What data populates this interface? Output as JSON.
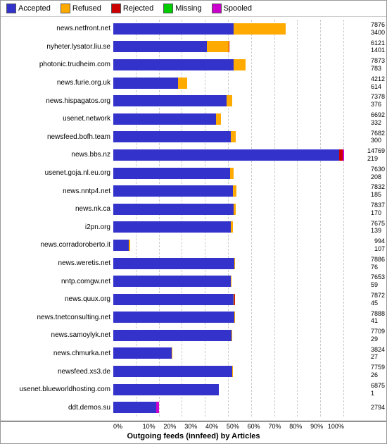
{
  "legend": {
    "items": [
      {
        "label": "Accepted",
        "color": "#3333cc",
        "class": "color-accepted"
      },
      {
        "label": "Refused",
        "color": "#ffaa00",
        "class": "color-refused"
      },
      {
        "label": "Rejected",
        "color": "#cc0000",
        "class": "color-rejected"
      },
      {
        "label": "Missing",
        "color": "#00cc00",
        "class": "color-missing"
      },
      {
        "label": "Spooled",
        "color": "#cc00cc",
        "class": "color-spooled"
      }
    ]
  },
  "title": "Outgoing feeds (innfeed) by Articles",
  "xAxis": {
    "ticks": [
      "0%",
      "10%",
      "20%",
      "30%",
      "40%",
      "50%",
      "60%",
      "70%",
      "80%",
      "90%",
      "100%"
    ]
  },
  "bars": [
    {
      "label": "news.netfront.net",
      "accepted": 7876,
      "refused": 3400,
      "rejected": 0,
      "missing": 0,
      "spooled": 0,
      "total": 11276,
      "val1": "7876",
      "val2": "3400"
    },
    {
      "label": "nyheter.lysator.liu.se",
      "accepted": 6121,
      "refused": 1401,
      "rejected": 30,
      "missing": 0,
      "spooled": 0,
      "total": 7552,
      "val1": "6121",
      "val2": "1401"
    },
    {
      "label": "photonic.trudheim.com",
      "accepted": 7873,
      "refused": 783,
      "rejected": 0,
      "missing": 0,
      "spooled": 0,
      "total": 8656,
      "val1": "7873",
      "val2": "783"
    },
    {
      "label": "news.furie.org.uk",
      "accepted": 4212,
      "refused": 614,
      "rejected": 0,
      "missing": 0,
      "spooled": 0,
      "total": 4826,
      "val1": "4212",
      "val2": "614"
    },
    {
      "label": "news.hispagatos.org",
      "accepted": 7378,
      "refused": 376,
      "rejected": 0,
      "missing": 0,
      "spooled": 0,
      "total": 7754,
      "val1": "7378",
      "val2": "376"
    },
    {
      "label": "usenet.network",
      "accepted": 6692,
      "refused": 332,
      "rejected": 0,
      "missing": 0,
      "spooled": 0,
      "total": 7024,
      "val1": "6692",
      "val2": "332"
    },
    {
      "label": "newsfeed.bofh.team",
      "accepted": 7682,
      "refused": 300,
      "rejected": 0,
      "missing": 0,
      "spooled": 0,
      "total": 7982,
      "val1": "7682",
      "val2": "300"
    },
    {
      "label": "news.bbs.nz",
      "accepted": 14769,
      "refused": 0,
      "rejected": 219,
      "missing": 0,
      "spooled": 80,
      "total": 15068,
      "val1": "14769",
      "val2": "219"
    },
    {
      "label": "usenet.goja.nl.eu.org",
      "accepted": 7630,
      "refused": 208,
      "rejected": 0,
      "missing": 0,
      "spooled": 0,
      "total": 7838,
      "val1": "7630",
      "val2": "208"
    },
    {
      "label": "news.nntp4.net",
      "accepted": 7832,
      "refused": 185,
      "rejected": 0,
      "missing": 0,
      "spooled": 0,
      "total": 8017,
      "val1": "7832",
      "val2": "185"
    },
    {
      "label": "news.nk.ca",
      "accepted": 7837,
      "refused": 170,
      "rejected": 0,
      "missing": 0,
      "spooled": 0,
      "total": 8007,
      "val1": "7837",
      "val2": "170"
    },
    {
      "label": "i2pn.org",
      "accepted": 7675,
      "refused": 139,
      "rejected": 0,
      "missing": 0,
      "spooled": 0,
      "total": 7814,
      "val1": "7675",
      "val2": "139"
    },
    {
      "label": "news.corradoroberto.it",
      "accepted": 994,
      "refused": 107,
      "rejected": 0,
      "missing": 0,
      "spooled": 0,
      "total": 1101,
      "val1": "994",
      "val2": "107"
    },
    {
      "label": "news.weretis.net",
      "accepted": 7886,
      "refused": 76,
      "rejected": 0,
      "missing": 0,
      "spooled": 0,
      "total": 7962,
      "val1": "7886",
      "val2": "76"
    },
    {
      "label": "nntp.comgw.net",
      "accepted": 7653,
      "refused": 59,
      "rejected": 0,
      "missing": 0,
      "spooled": 0,
      "total": 7712,
      "val1": "7653",
      "val2": "59"
    },
    {
      "label": "news.quux.org",
      "accepted": 7872,
      "refused": 45,
      "rejected": 20,
      "missing": 0,
      "spooled": 0,
      "total": 7937,
      "val1": "7872",
      "val2": "45"
    },
    {
      "label": "news.tnetconsulting.net",
      "accepted": 7888,
      "refused": 41,
      "rejected": 0,
      "missing": 0,
      "spooled": 0,
      "total": 7929,
      "val1": "7888",
      "val2": "41"
    },
    {
      "label": "news.samoylyk.net",
      "accepted": 7709,
      "refused": 29,
      "rejected": 0,
      "missing": 0,
      "spooled": 0,
      "total": 7738,
      "val1": "7709",
      "val2": "29"
    },
    {
      "label": "news.chmurka.net",
      "accepted": 3824,
      "refused": 27,
      "rejected": 0,
      "missing": 0,
      "spooled": 0,
      "total": 3851,
      "val1": "3824",
      "val2": "27"
    },
    {
      "label": "newsfeed.xs3.de",
      "accepted": 7759,
      "refused": 26,
      "rejected": 0,
      "missing": 0,
      "spooled": 0,
      "total": 7785,
      "val1": "7759",
      "val2": "26"
    },
    {
      "label": "usenet.blueworldhosting.com",
      "accepted": 6875,
      "refused": 1,
      "rejected": 0,
      "missing": 0,
      "spooled": 0,
      "total": 6876,
      "val1": "6875",
      "val2": "1"
    },
    {
      "label": "ddt.demos.su",
      "accepted": 2794,
      "refused": 0,
      "rejected": 0,
      "missing": 0,
      "spooled": 200,
      "total": 2994,
      "val1": "2794",
      "val2": ""
    }
  ],
  "maxTotal": 15068
}
